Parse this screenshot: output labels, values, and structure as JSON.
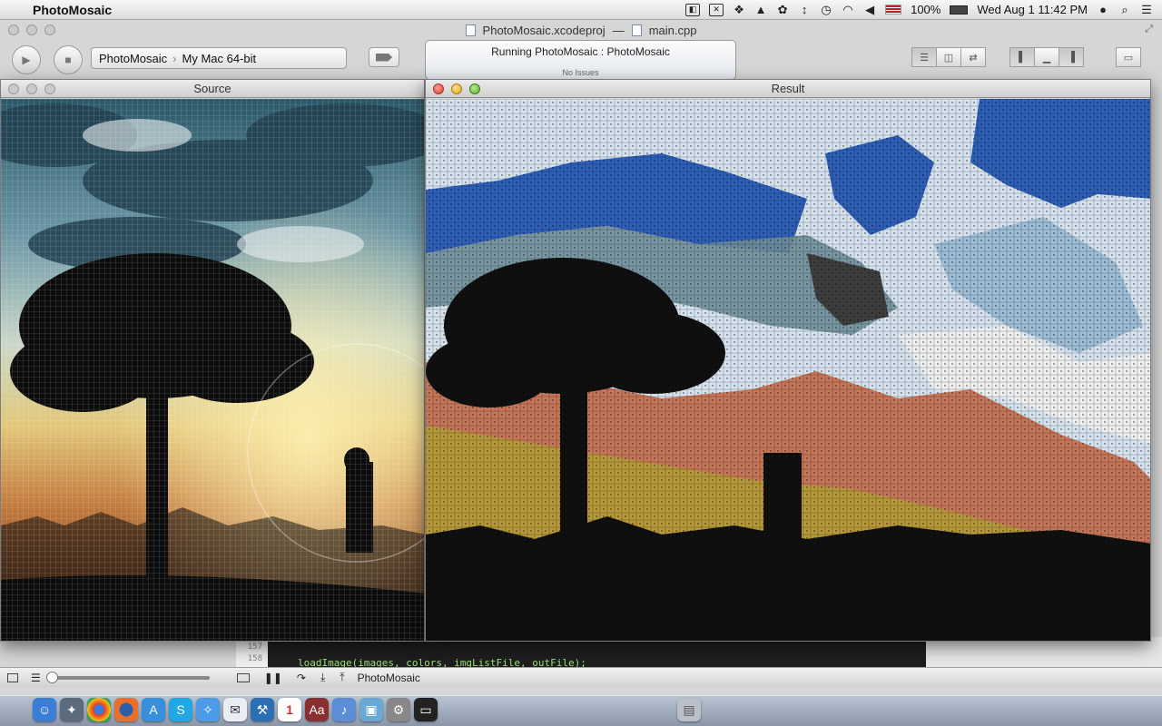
{
  "menubar": {
    "app_name": "PhotoMosaic",
    "battery": "100%",
    "clock": "Wed Aug 1  11:42 PM"
  },
  "xcode": {
    "window_title": "PhotoMosaic.xcodeproj",
    "separator": "—",
    "file_title": "main.cpp",
    "scheme_target": "PhotoMosaic",
    "scheme_destination": "My Mac 64-bit",
    "activity_status": "Running PhotoMosaic : PhotoMosaic",
    "activity_issues": "No Issues",
    "toolbar_labels": [
      "Run",
      "Stop",
      "Scheme",
      "Breakpoints",
      "Editor",
      "View",
      "Organizer"
    ]
  },
  "source_window": {
    "title": "Source"
  },
  "result_window": {
    "title": "Result"
  },
  "code": {
    "line_numbers": [
      "157",
      "158"
    ],
    "visible_line": "loadImage(images, colors, imgListFile, outFile);"
  },
  "debugbar": {
    "process_label": "PhotoMosaic"
  },
  "dock": {
    "icons": [
      "finder-icon",
      "launchpad-icon",
      "chrome-icon",
      "firefox-icon",
      "app-store-icon",
      "skype-icon",
      "safari-icon",
      "mail-icon",
      "xcode-icon",
      "ical-icon",
      "dictionary-icon",
      "itunes-icon",
      "preview-icon",
      "system-preferences-icon",
      "terminal-icon",
      "trash-icon"
    ]
  },
  "colors": {
    "sky_blue": "#2f60b8",
    "cloud_white": "#d9e6f2",
    "sunset_orange": "#c8785a",
    "gold": "#b89a3a",
    "silhouette": "#0d0d0d"
  }
}
